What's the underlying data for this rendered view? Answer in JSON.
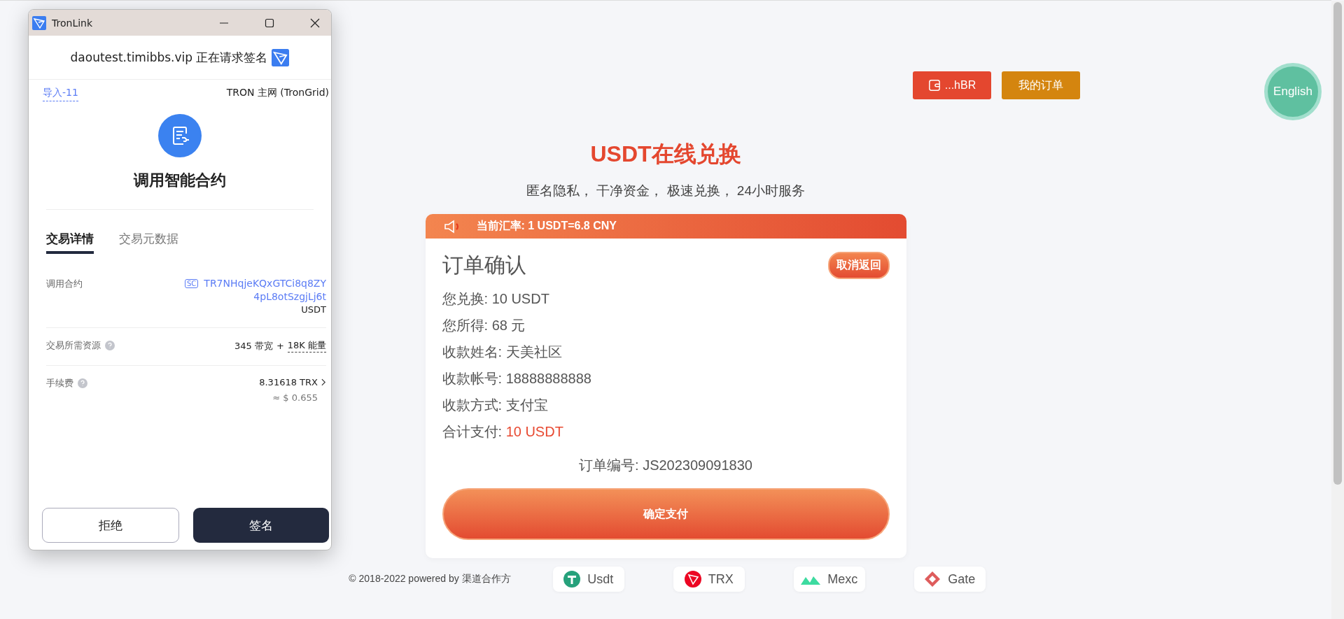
{
  "header": {
    "wallet_button": "...hBR",
    "orders_button": "我的订单",
    "language_button": "English"
  },
  "hero": {
    "title": "USDT在线兑换",
    "subtitle": "匿名隐私， 干净资金， 极速兑换， 24小时服务"
  },
  "notice": {
    "text": "当前汇率: 1 USDT=6.8 CNY"
  },
  "order": {
    "title": "订单确认",
    "cancel_button": "取消返回",
    "lines": [
      {
        "label": "您兑换: ",
        "value": "10 USDT",
        "highlight": false
      },
      {
        "label": "您所得: ",
        "value": "68 元",
        "highlight": false
      },
      {
        "label": "收款姓名: ",
        "value": "天美社区",
        "highlight": false
      },
      {
        "label": "收款帐号: ",
        "value": "18888888888",
        "highlight": false
      },
      {
        "label": "收款方式: ",
        "value": "支付宝",
        "highlight": false
      },
      {
        "label": "合计支付: ",
        "value": "10 USDT",
        "highlight": true
      }
    ],
    "order_number": "订单编号: JS202309091830",
    "confirm_button": "确定支付"
  },
  "footer": {
    "copyright": "© 2018-2022 powered by 渠道合作方",
    "badges": [
      {
        "kind": "usdt",
        "label": "Usdt"
      },
      {
        "kind": "trx",
        "label": "TRX"
      },
      {
        "kind": "mexc",
        "label": "Mexc"
      },
      {
        "kind": "gate",
        "label": "Gate"
      }
    ]
  },
  "popup": {
    "window": {
      "title": "TronLink"
    },
    "request": "daoutest.timibbs.vip 正在请求签名",
    "account": "导入-11",
    "network": "TRON 主网 (TronGrid)",
    "heading": "调用智能合约",
    "tabs": [
      {
        "label": "交易详情",
        "selected": true
      },
      {
        "label": "交易元数据",
        "selected": false
      }
    ],
    "contract": {
      "label": "调用合约",
      "badge": "SC",
      "address_lines": [
        "TR7NHqjeKQxGTCi8q8ZY",
        "4pL8otSzgjLj6t"
      ],
      "token": "USDT"
    },
    "resources": {
      "label": "交易所需资源",
      "bandwidth": "345 带宽",
      "plus": "+",
      "energy": "18K 能量"
    },
    "fee": {
      "label": "手续费",
      "amount": "8.31618 TRX",
      "usd": "≈ $ 0.655"
    },
    "buttons": {
      "reject": "拒绝",
      "sign": "签名"
    }
  }
}
